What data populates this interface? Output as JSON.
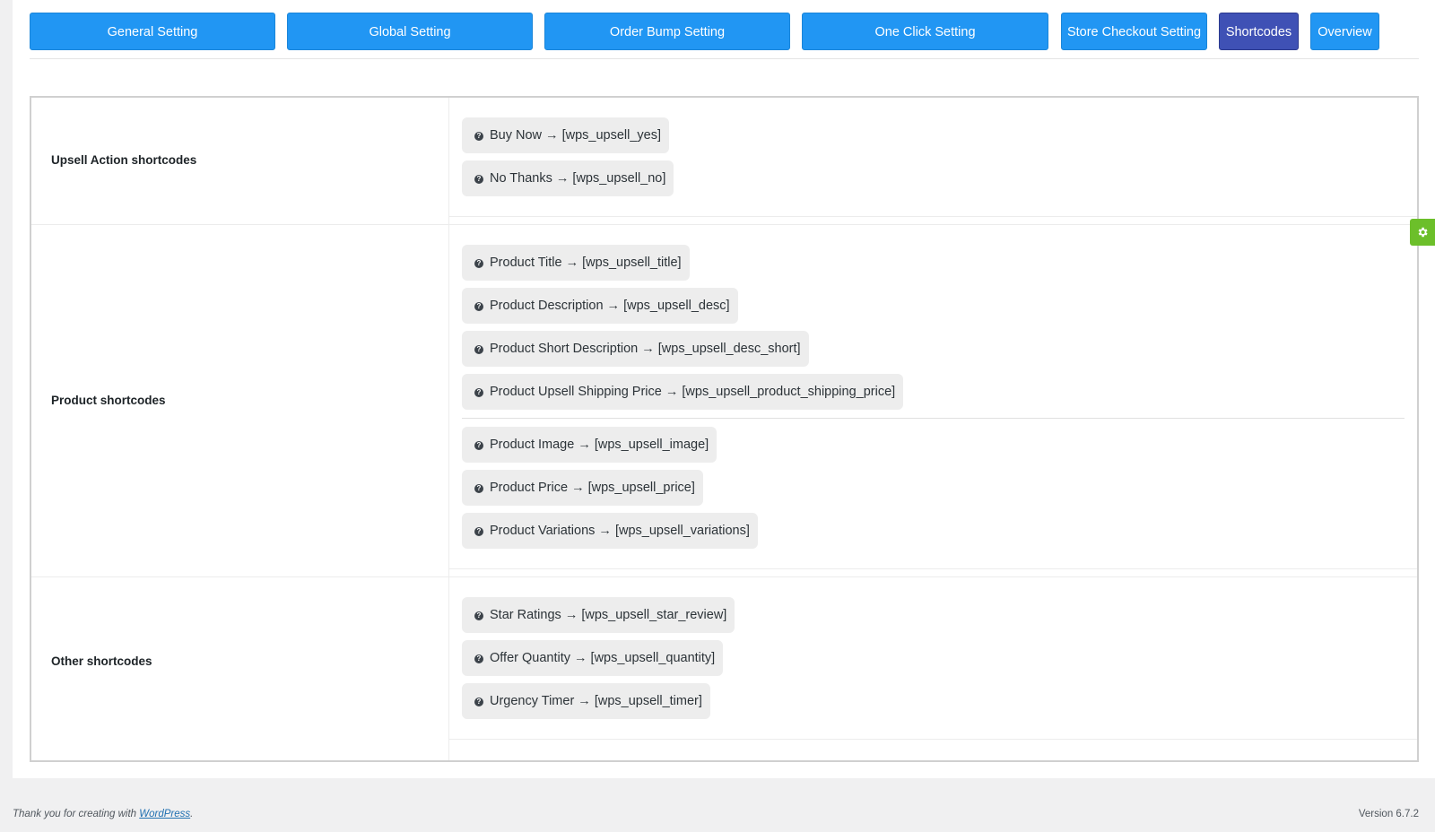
{
  "tabs": [
    {
      "label": "General Setting"
    },
    {
      "label": "Global Setting"
    },
    {
      "label": "Order Bump Setting"
    },
    {
      "label": "One Click Setting"
    },
    {
      "label": "Store Checkout Setting"
    },
    {
      "label": "Shortcodes",
      "active": true
    },
    {
      "label": "Overview"
    }
  ],
  "colors": {
    "tab": "#2196f3",
    "tab_active": "#3f51b5",
    "gear": "#6cbf2a"
  },
  "sections": [
    {
      "label": "Upsell Action shortcodes",
      "items": [
        "Buy Now → [wps_upsell_yes]",
        "No Thanks → [wps_upsell_no]"
      ]
    },
    {
      "label": "Product shortcodes",
      "items": [
        "Product Title → [wps_upsell_title]",
        "Product Description → [wps_upsell_desc]",
        "Product Short Description → [wps_upsell_desc_short]",
        "Product Upsell Shipping Price → [wps_upsell_product_shipping_price]",
        "Product Image → [wps_upsell_image]",
        "Product Price → [wps_upsell_price]",
        "Product Variations → [wps_upsell_variations]"
      ]
    },
    {
      "label": "Other shortcodes",
      "items": [
        "Star Ratings → [wps_upsell_star_review]",
        "Offer Quantity → [wps_upsell_quantity]",
        "Urgency Timer → [wps_upsell_timer]"
      ]
    }
  ],
  "item_icon": "question-circle-icon",
  "side_button_icon": "gear-icon",
  "footer": {
    "thanks_prefix": "Thank you for creating with ",
    "thanks_link": "WordPress",
    "thanks_suffix": ".",
    "version": "Version 6.7.2"
  }
}
